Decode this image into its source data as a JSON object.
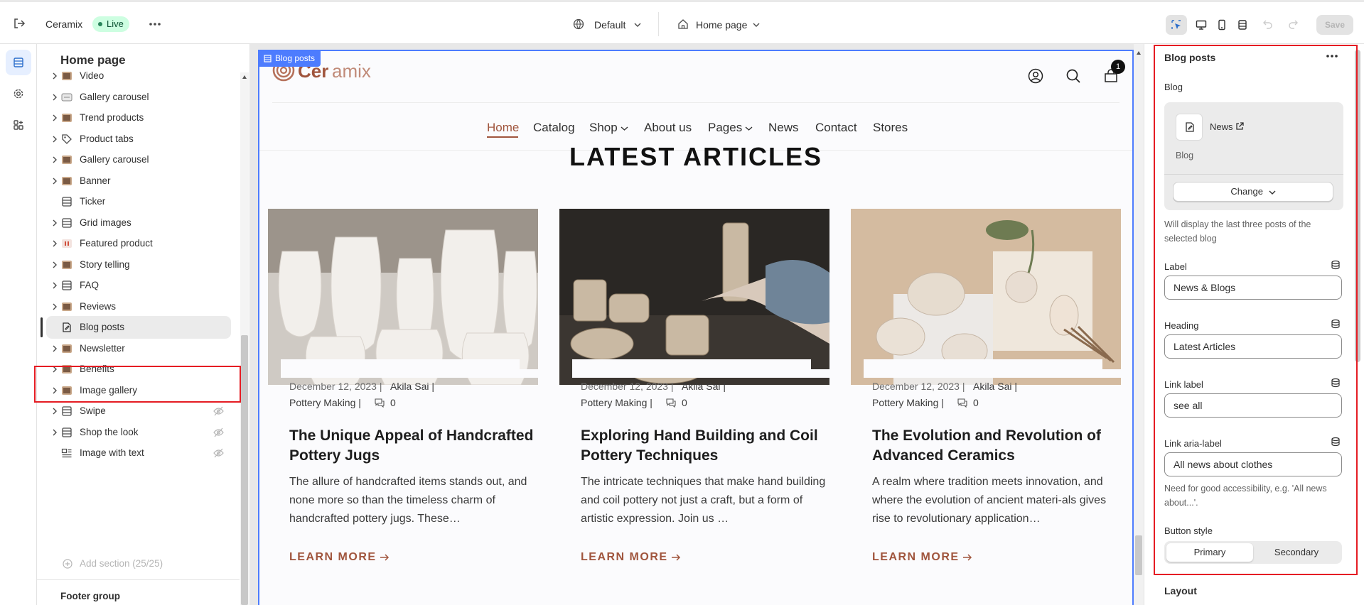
{
  "topbar": {
    "store_name": "Ceramix",
    "status": "Live",
    "theme_select": "Default",
    "page_select": "Home page",
    "save_label": "Save"
  },
  "left_panel": {
    "title": "Home page",
    "sections": [
      {
        "label": "Video",
        "icon": "image-thumb-icon",
        "hidden": false
      },
      {
        "label": "Gallery carousel",
        "icon": "carousel-icon",
        "hidden": false
      },
      {
        "label": "Trend products",
        "icon": "image-thumb-icon",
        "hidden": false
      },
      {
        "label": "Product tabs",
        "icon": "tag-icon",
        "hidden": false
      },
      {
        "label": "Gallery carousel",
        "icon": "image-thumb-icon",
        "hidden": false
      },
      {
        "label": "Banner",
        "icon": "image-thumb-icon",
        "hidden": false
      },
      {
        "label": "Ticker",
        "icon": "layout-rows-icon",
        "hidden": false
      },
      {
        "label": "Grid images",
        "icon": "layout-rows-icon",
        "hidden": false
      },
      {
        "label": "Featured product",
        "icon": "product-icon",
        "hidden": false
      },
      {
        "label": "Story telling",
        "icon": "image-thumb-icon",
        "hidden": false
      },
      {
        "label": "FAQ",
        "icon": "layout-rows-icon",
        "hidden": false
      },
      {
        "label": "Reviews",
        "icon": "image-thumb-icon",
        "hidden": false
      },
      {
        "label": "Blog posts",
        "icon": "blog-icon",
        "hidden": false,
        "selected": true
      },
      {
        "label": "Newsletter",
        "icon": "image-thumb-icon",
        "hidden": false
      },
      {
        "label": "Benefits",
        "icon": "image-thumb-icon",
        "hidden": false
      },
      {
        "label": "Image gallery",
        "icon": "image-thumb-icon",
        "hidden": false
      },
      {
        "label": "Swipe",
        "icon": "layout-rows-icon",
        "hidden": true
      },
      {
        "label": "Shop the look",
        "icon": "layout-rows-icon",
        "hidden": true
      },
      {
        "label": "Image with text",
        "icon": "image-text-icon",
        "hidden": true
      }
    ],
    "add_section": "Add section (25/25)",
    "footer_group": "Footer group"
  },
  "preview": {
    "section_tag": "Blog posts",
    "logo_prefix": "Cer",
    "logo_suffix": "amix",
    "cart_count": "1",
    "nav": [
      "Home",
      "Catalog",
      "Shop",
      "About us",
      "Pages",
      "News",
      "Contact",
      "Stores"
    ],
    "heading": "LATEST ARTICLES",
    "articles": [
      {
        "date": "December 12, 2023 |",
        "author": "Akila Sai |",
        "category": "Pottery Making |",
        "comments": "0",
        "title": "The Unique Appeal of Handcrafted Pottery Jugs",
        "excerpt": "The allure of handcrafted items stands out, and none more so than the timeless charm of handcrafted pottery jugs. These…",
        "cta": "LEARN MORE"
      },
      {
        "date": "December 12, 2023 |",
        "author": "Akila Sai |",
        "category": "Pottery Making |",
        "comments": "0",
        "title": "Exploring Hand Building and Coil Pottery Techniques",
        "excerpt": "The intricate techniques that make hand building and coil pottery not just a craft, but a form of artistic expression. Join us …",
        "cta": "LEARN MORE"
      },
      {
        "date": "December 12, 2023 |",
        "author": "Akila Sai |",
        "category": "Pottery Making |",
        "comments": "0",
        "title": "The Evolution and Revolution of Advanced Ceramics",
        "excerpt": "A realm where tradition meets innovation, and where the evolution of ancient materi-als gives rise to revolutionary application…",
        "cta": "LEARN MORE"
      }
    ]
  },
  "right_panel": {
    "title": "Blog posts",
    "blog_label": "Blog",
    "blog_name": "News",
    "blog_type": "Blog",
    "change_label": "Change",
    "blog_help": "Will display the last three posts of the selected blog",
    "fields": {
      "label": {
        "label": "Label",
        "value": "News & Blogs"
      },
      "heading": {
        "label": "Heading",
        "value": "Latest Articles"
      },
      "link_label": {
        "label": "Link label",
        "value": "see all"
      },
      "link_aria": {
        "label": "Link aria-label",
        "value": "All news about clothes"
      }
    },
    "aria_help": "Need for good accessibility, e.g. 'All news about...'.",
    "button_style_label": "Button style",
    "button_styles": [
      "Primary",
      "Secondary"
    ],
    "layout_label": "Layout"
  },
  "colors": {
    "accent": "#4d7cfe",
    "brand": "#a0553d",
    "highlight": "#e51c23"
  }
}
